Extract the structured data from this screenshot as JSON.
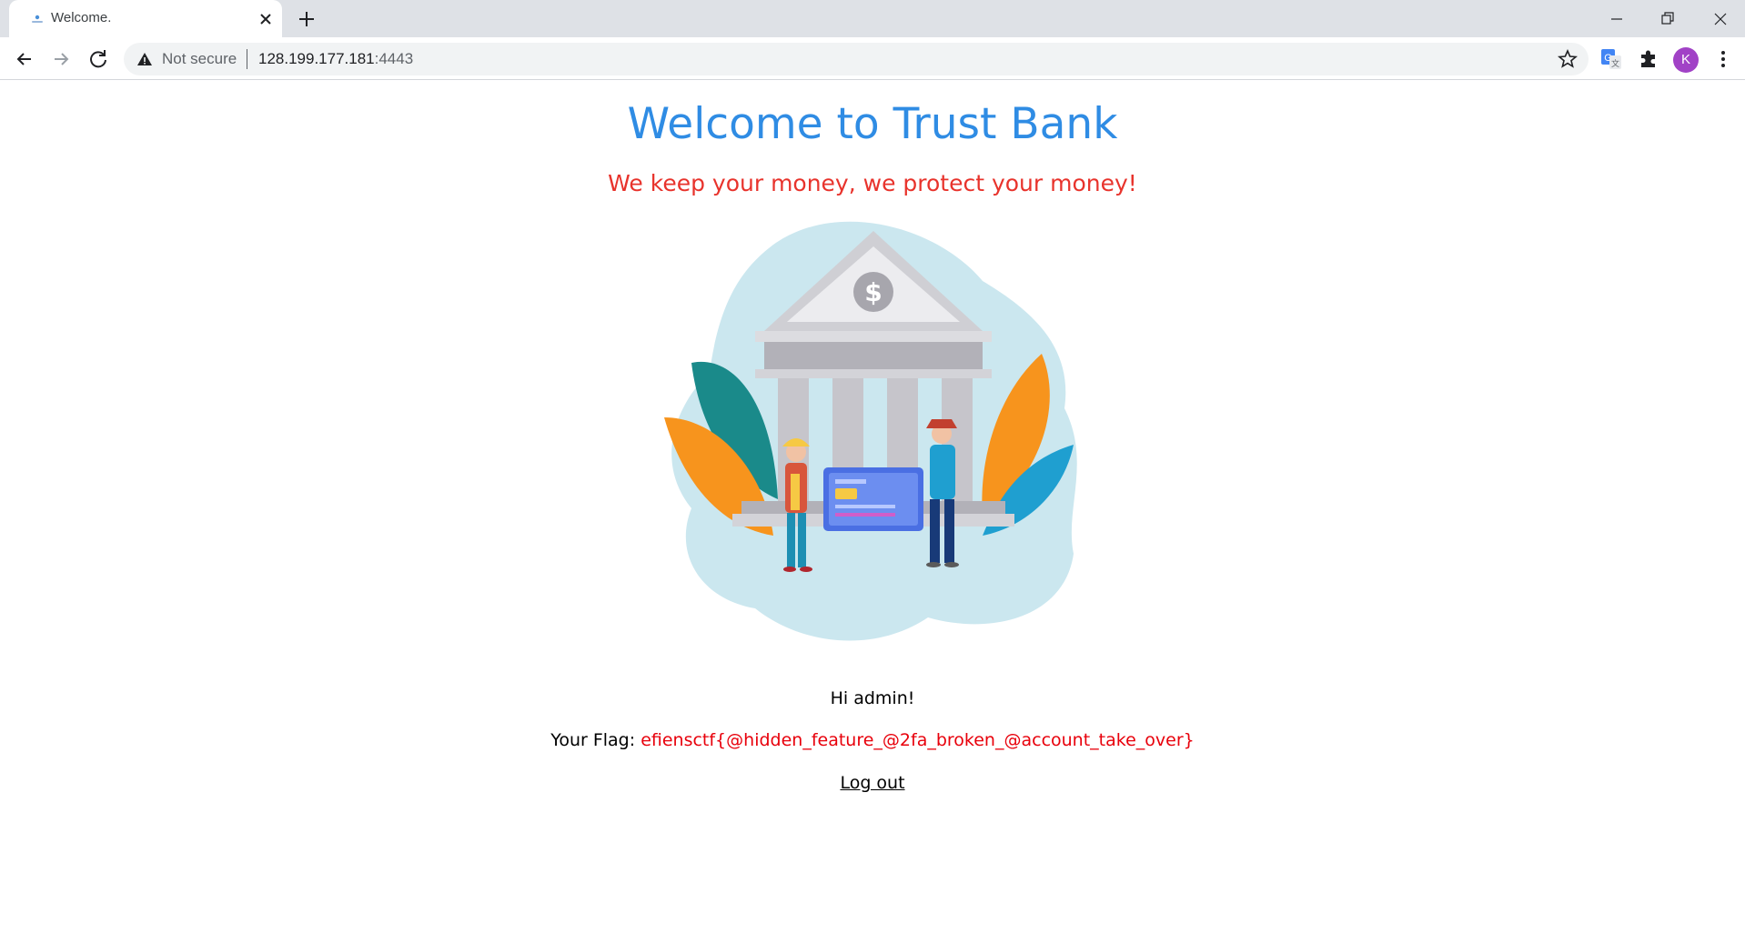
{
  "browser": {
    "tab": {
      "title": "Welcome.",
      "favicon": "page-icon"
    },
    "address": {
      "security_text": "Not secure",
      "url_host": "128.199.177.181",
      "url_port": ":4443"
    },
    "profile_initial": "K",
    "icons": [
      "back-icon",
      "forward-icon",
      "reload-icon",
      "warning-icon",
      "star-icon",
      "translate-icon",
      "extensions-icon",
      "more-icon",
      "minimize-icon",
      "restore-icon",
      "close-window-icon"
    ]
  },
  "page": {
    "title": "Welcome to Trust Bank",
    "subtitle": "We keep your money, we protect your money!",
    "greeting": "Hi admin!",
    "flag_label": "Your Flag: ",
    "flag_value": "efiensctf{@hidden_feature_@2fa_broken_@account_take_over}",
    "logout_label": "Log out"
  },
  "colors": {
    "title": "#2f8ce4",
    "subtitle": "#e8332c",
    "flag": "#e8000b",
    "avatar": "#a142c6"
  }
}
